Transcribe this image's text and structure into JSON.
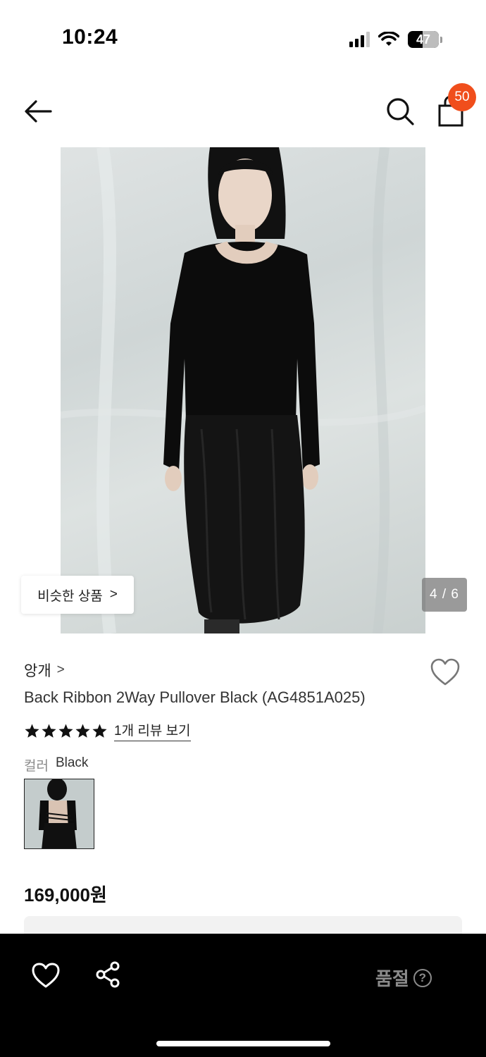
{
  "status_bar": {
    "time": "10:24",
    "battery": "47",
    "battery_level": 0.47
  },
  "nav": {
    "cart_count": "50",
    "back_icon": "arrow-left-icon",
    "search_icon": "search-icon",
    "cart_icon": "shopping-bag-icon"
  },
  "gallery": {
    "similar_label": "비슷한 상품",
    "similar_chevron": ">",
    "counter": "4 / 6",
    "current_index": 4,
    "total": 6
  },
  "product": {
    "brand": "앙개",
    "brand_chevron": ">",
    "name": "Back Ribbon 2Way Pullover Black (AG4851A025)",
    "rating_stars": 5,
    "review_link": "1개 리뷰 보기",
    "color_label": "컬러",
    "color_value": "Black",
    "price": "169,000원"
  },
  "bottom_bar": {
    "soldout_label": "품절",
    "help_icon": "?",
    "wishlist_icon": "heart-icon",
    "share_icon": "share-icon"
  },
  "colors": {
    "badge": "#f04e1c",
    "bottom_bar": "#000000",
    "soldout_text": "#8a8a8a"
  }
}
